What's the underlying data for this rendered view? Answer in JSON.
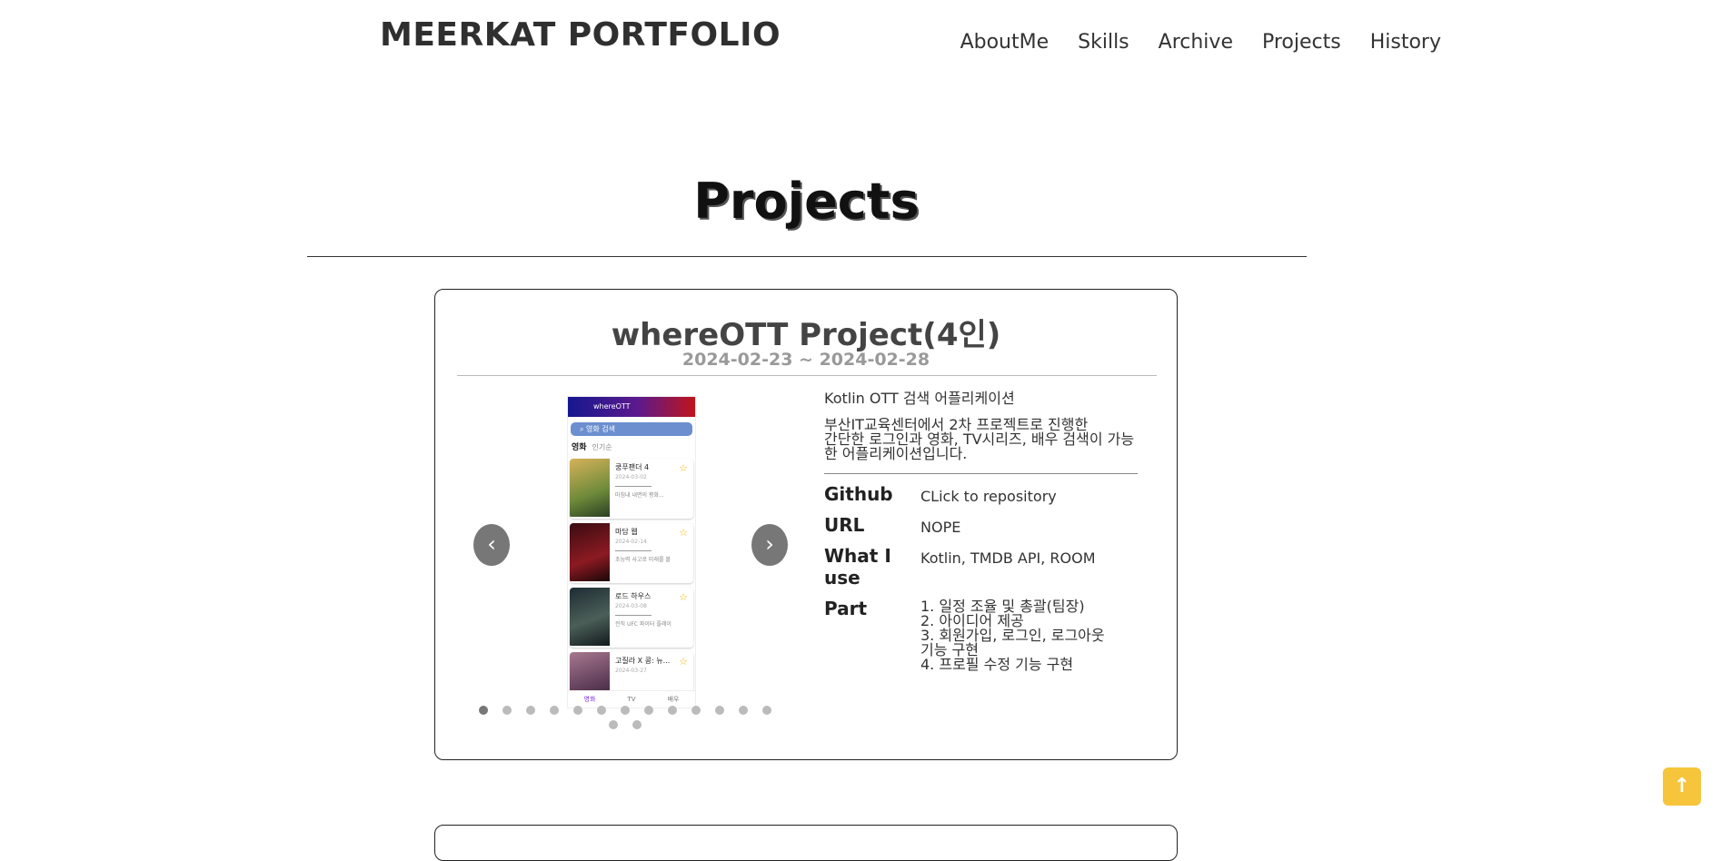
{
  "header": {
    "logo": "MEERKAT PORTFOLIO",
    "nav": [
      "AboutMe",
      "Skills",
      "Archive",
      "Projects",
      "History"
    ]
  },
  "section": {
    "title": "Projects"
  },
  "project": {
    "title": "whereOTT Project(4인)",
    "date": "2024-02-23 ~ 2024-02-28",
    "intro": "Kotlin OTT 검색 어플리케이션",
    "description": "부산IT교육센터에서 2차 프로젝트로 진행한\n간단한 로그인과 영화, TV시리즈, 배우 검색이 가능\n한 어플리케이션입니다.",
    "github_label": "Github",
    "github_value": "CLick to repository",
    "url_label": "URL",
    "url_value": "NOPE",
    "use_label": "What I use",
    "use_value": "Kotlin, TMDB API, ROOM",
    "part_label": "Part",
    "parts": [
      "1. 일정 조율 및 총괄(팀장)",
      "2. 아이디어 제공",
      "3. 회원가입, 로그인, 로그아웃",
      "기능 구현",
      "4. 프로필 수정 기능 구현"
    ],
    "carousel": {
      "prev": "‹",
      "next": "›",
      "slide_count": 15,
      "active_index": 0
    },
    "screenshot": {
      "app_name": "whereOTT",
      "search_placeholder": "영화 검색",
      "tab_active": "영화",
      "tab_sub": "인기순",
      "movies": [
        {
          "title": "쿵푸팬더 4",
          "date": "2024-03-02",
          "summary": "마침내 내면의 평화...",
          "poster": "#b88f3c"
        },
        {
          "title": "마담 웹",
          "date": "2024-02-14",
          "summary": "초능력 사고로 미래를 볼",
          "poster": "#5a1016"
        },
        {
          "title": "로드 하우스",
          "date": "2024-03-08",
          "summary": "전직 UFC 파이터 플레이",
          "poster": "#24343a"
        },
        {
          "title": "고질라 X 콩: 뉴...",
          "date": "2024-03-27",
          "summary": "",
          "poster": "#8a5a70"
        }
      ],
      "bottom_tabs": [
        "영화",
        "TV",
        "배우"
      ]
    }
  },
  "top_button": "↑"
}
